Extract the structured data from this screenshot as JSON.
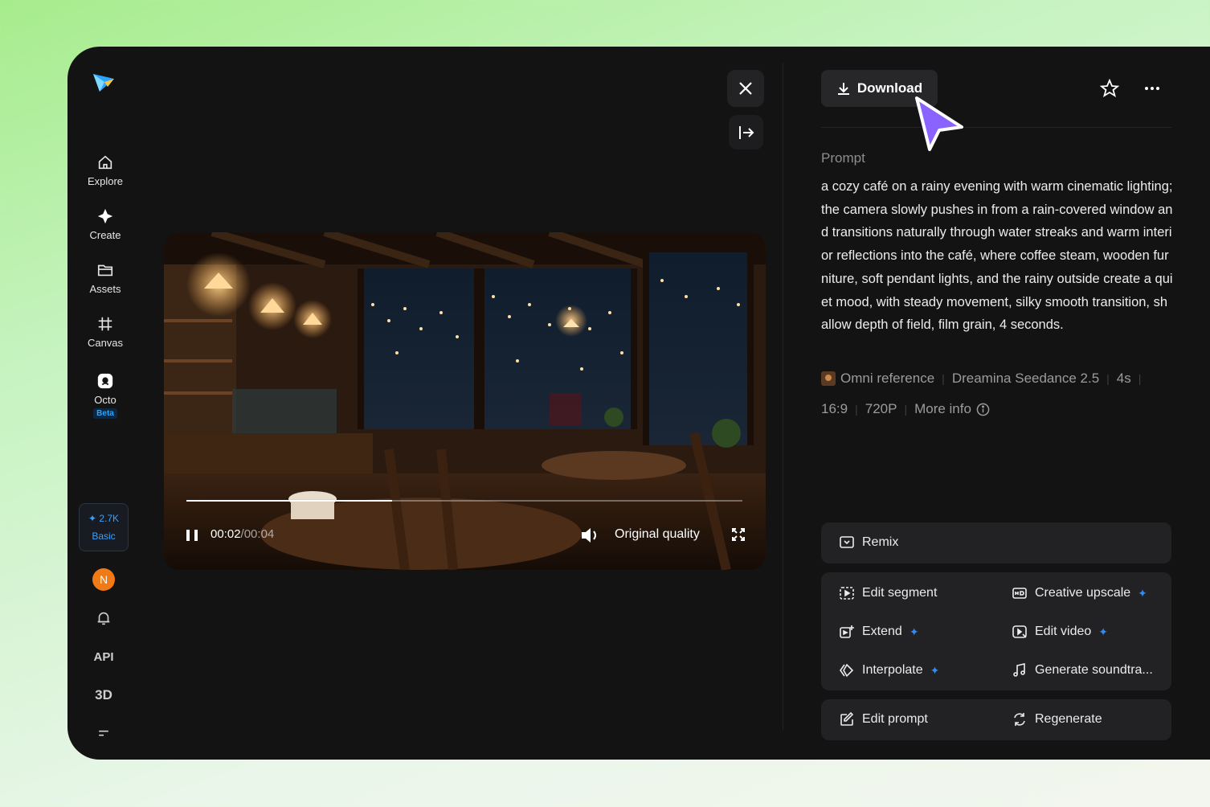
{
  "nav": {
    "items": [
      {
        "label": "Explore"
      },
      {
        "label": "Create"
      },
      {
        "label": "Assets"
      },
      {
        "label": "Canvas"
      },
      {
        "label": "Octo",
        "badge": "Beta"
      }
    ],
    "credits": {
      "amount": "2.7K",
      "plan": "Basic"
    },
    "avatar_initial": "N",
    "api_label": "API",
    "three_d_label": "3D"
  },
  "player": {
    "current_time": "00:02",
    "separator": "/",
    "duration": "00:04",
    "progress_fraction": 0.37,
    "quality": "Original quality"
  },
  "panel": {
    "download_label": "Download",
    "prompt_label": "Prompt",
    "prompt_text": "a cozy café on a rainy evening with warm cinematic lighting; the camera slowly pushes in from a rain-covered window and transitions naturally through water streaks and warm interior reflections into the café, where coffee steam, wooden furniture, soft pendant lights, and the rainy outside create a quiet mood, with steady movement, silky smooth transition, shallow depth of field, film grain, 4 seconds.",
    "meta_row1": [
      "Omni reference",
      "Dreamina Seedance 2.5",
      "4s"
    ],
    "meta_row2": [
      "16:9",
      "720P",
      "More info"
    ]
  },
  "actions": {
    "remix": "Remix",
    "edit_segment": "Edit segment",
    "creative_upscale": "Creative upscale",
    "extend": "Extend",
    "edit_video": "Edit video",
    "interpolate": "Interpolate",
    "generate_soundtrack": "Generate soundtra...",
    "edit_prompt": "Edit prompt",
    "regenerate": "Regenerate"
  },
  "colors": {
    "accent": "#2a8cff",
    "cursor": "#8a63ff",
    "avatar": "#f07a16"
  }
}
